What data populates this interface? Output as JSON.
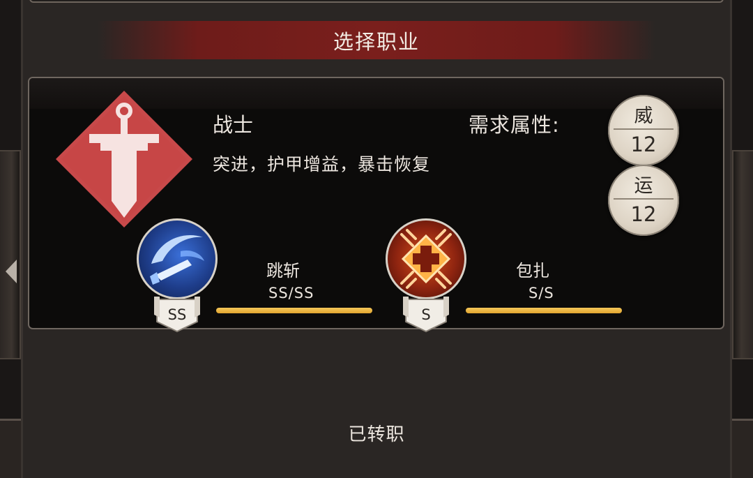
{
  "dialog": {
    "title": "选择职业",
    "status": "已转职"
  },
  "class": {
    "name": "战士",
    "icon": "sword-icon",
    "description": "突进，护甲增益，暴击恢复",
    "emblem_color": "#c8494a",
    "requirement_label": "需求属性:",
    "requirements": [
      {
        "stat": "威",
        "value": "12"
      },
      {
        "stat": "运",
        "value": "12"
      }
    ]
  },
  "skills": [
    {
      "name": "跳斩",
      "grade": "SS/SS",
      "rank": "SS",
      "icon": "leap-slash-icon",
      "progress": 1.0
    },
    {
      "name": "包扎",
      "grade": "S/S",
      "rank": "S",
      "icon": "bandage-cross-icon",
      "progress": 1.0
    }
  ],
  "colors": {
    "accent_bar": "#e8b444",
    "title_bar": "#7a1f1c"
  }
}
